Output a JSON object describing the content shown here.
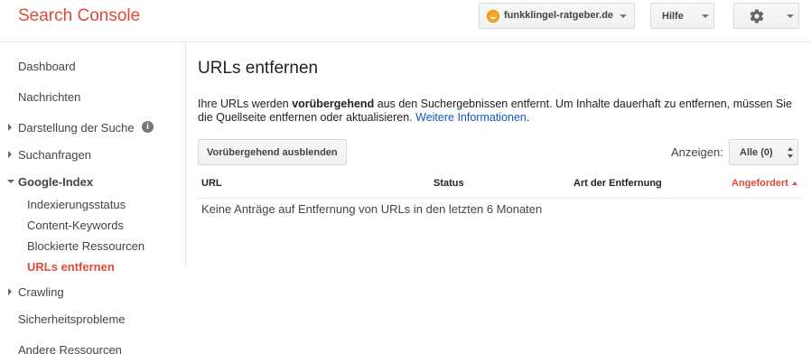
{
  "header": {
    "brand": "Search Console",
    "site": "funkklingel-ratgeber.de",
    "help_label": "Hilfe"
  },
  "sidebar": {
    "items": [
      {
        "label": "Dashboard"
      },
      {
        "label": "Nachrichten"
      },
      {
        "label": "Darstellung der Suche"
      },
      {
        "label": "Suchanfragen"
      },
      {
        "label": "Google-Index"
      },
      {
        "label": "Crawling"
      },
      {
        "label": "Sicherheitsprobleme"
      },
      {
        "label": "Andere Ressourcen"
      }
    ],
    "google_index_subitems": [
      {
        "label": "Indexierungsstatus"
      },
      {
        "label": "Content-Keywords"
      },
      {
        "label": "Blockierte Ressourcen"
      },
      {
        "label": "URLs entfernen"
      }
    ],
    "info_glyph": "i"
  },
  "main": {
    "title": "URLs entfernen",
    "desc_part1": "Ihre URLs werden ",
    "desc_bold": "vorübergehend",
    "desc_part2": " aus den Suchergebnissen entfernt. Um Inhalte dauerhaft zu entfernen, müssen Sie die Quellseite entfernen oder aktualisieren. ",
    "desc_link": "Weitere Informationen",
    "desc_end": ".",
    "hide_button": "Vorübergehend ausblenden",
    "show_label": "Anzeigen:",
    "show_value": "Alle (0)",
    "columns": [
      "URL",
      "Status",
      "Art der Entfernung",
      "Angefordert"
    ],
    "empty_message": "Keine Anträge auf Entfernung von URLs in den letzten 6 Monaten"
  },
  "colors": {
    "brand": "#dd4b39",
    "link": "#1155cc",
    "site_favicon": "#f5a623"
  },
  "icons": [
    "site-favicon-icon",
    "chevron-down-icon",
    "gear-icon",
    "info-icon",
    "triangle-right-icon",
    "triangle-down-icon",
    "sort-ascending-icon"
  ]
}
